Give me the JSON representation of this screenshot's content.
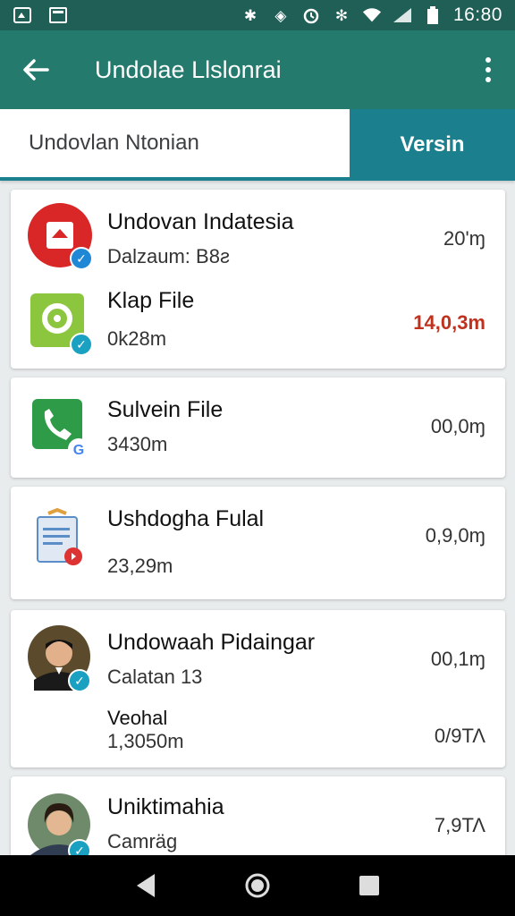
{
  "status_bar": {
    "time": "16:80",
    "left_icons": [
      "notification-icon",
      "screenshot-icon"
    ],
    "right_icons": [
      "bluetooth-icon",
      "vibrate-icon",
      "alarm-icon",
      "nfc-icon",
      "wifi-icon",
      "signal-icon",
      "battery-icon"
    ]
  },
  "appbar": {
    "title": "Undolae Llslonrai",
    "back_icon": "back-arrow-icon",
    "menu_icon": "more-vert-icon",
    "color": "#237a6d"
  },
  "tabs": [
    {
      "label": "Undovlan Ntonian",
      "active": false
    },
    {
      "label": "Versin",
      "active": true
    }
  ],
  "accent": "#1c7f8e",
  "items": {
    "card1_row1": {
      "name": "Undovan Indatesia",
      "sub": "Dalzaum: B8ƨ",
      "size": "20'ɱ",
      "icon": "red-document-icon"
    },
    "card1_row2": {
      "name": "Klap File",
      "sub": "0k28m",
      "size": "14,0,3m",
      "icon": "green-app-icon"
    },
    "card2": {
      "name": "Sulvein File",
      "sub": "3430m",
      "size": "00,0ɱ",
      "icon": "phone-icon"
    },
    "card3": {
      "name": "Ushdogha Fulal",
      "sub": "23,29m",
      "size": "0,9,0ɱ",
      "icon": "clipboard-icon"
    },
    "card4": {
      "name": "Undowaah Pidaingar",
      "sub": "Calatan 13",
      "size": "00,1ɱ",
      "label2": "Veohal",
      "sub2": "1,3050m",
      "size2": "0/9ΤΛ",
      "icon": "avatar-man"
    },
    "card5": {
      "name": "Uniktimahia",
      "sub": "Camräg",
      "size": "7,9ΤΛ",
      "icon": "avatar-woman"
    }
  },
  "nav": [
    "back-triangle-icon",
    "home-circle-icon",
    "recents-square-icon"
  ]
}
